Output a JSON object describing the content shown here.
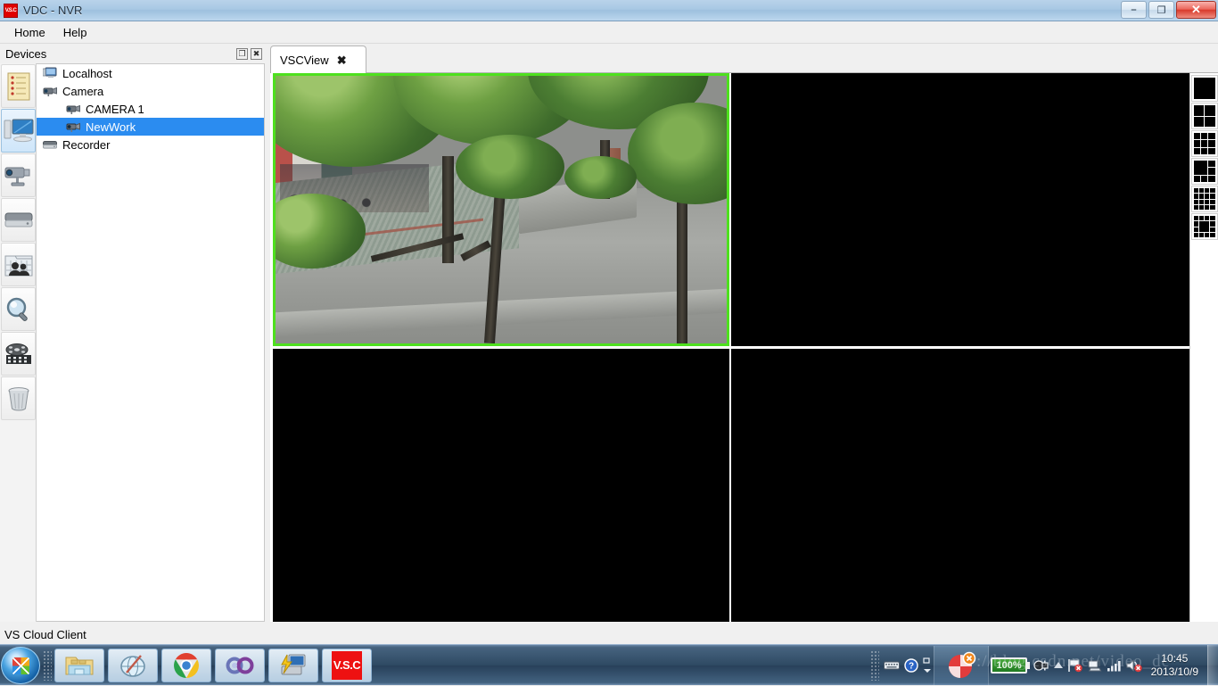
{
  "window": {
    "title": "VDC - NVR",
    "app_icon": "V.S.C",
    "controls": {
      "minimize": "–",
      "restore": "❐",
      "close": "✕"
    }
  },
  "menubar": {
    "items": [
      {
        "label": "Home",
        "icon": "menu-home"
      },
      {
        "label": "Help",
        "icon": "menu-help"
      }
    ]
  },
  "devices_dock": {
    "title": "Devices",
    "float_button": "❐",
    "close_button": "✖"
  },
  "rail": {
    "buttons": [
      {
        "name": "notes-list-icon",
        "active": false
      },
      {
        "name": "monitor-icon",
        "active": true
      },
      {
        "name": "camera-icon",
        "active": false
      },
      {
        "name": "harddisk-icon",
        "active": false
      },
      {
        "name": "users-group-icon",
        "active": false
      },
      {
        "name": "magnifier-search-icon",
        "active": false
      },
      {
        "name": "film-reel-icon",
        "active": false
      },
      {
        "name": "trash-bin-icon",
        "active": false
      }
    ]
  },
  "tree": {
    "nodes": [
      {
        "label": "Localhost",
        "level": 1,
        "icon": "computer-icon",
        "selected": false
      },
      {
        "label": "Camera",
        "level": 1,
        "icon": "camera-icon",
        "selected": false
      },
      {
        "label": "CAMERA 1",
        "level": 2,
        "icon": "camera-icon",
        "selected": false
      },
      {
        "label": "NewWork",
        "level": 2,
        "icon": "camera-icon",
        "selected": true
      },
      {
        "label": "Recorder",
        "level": 1,
        "icon": "harddisk-icon",
        "selected": false
      }
    ],
    "selection_color": "#2b8cf0"
  },
  "tabs": {
    "items": [
      {
        "label": "VSCView",
        "close": "✖",
        "active": true
      }
    ]
  },
  "video_grid": {
    "layout": "2x2",
    "active_border_color": "#4ee01e",
    "cells": [
      {
        "index": 1,
        "state": "live",
        "active": true,
        "label": ""
      },
      {
        "index": 2,
        "state": "empty",
        "active": false,
        "label": ""
      },
      {
        "index": 3,
        "state": "empty",
        "active": false,
        "label": ""
      },
      {
        "index": 4,
        "state": "empty",
        "active": false,
        "label": ""
      }
    ]
  },
  "layout_selector": {
    "options": [
      {
        "name": "layout-1",
        "cells": 1,
        "title": "1"
      },
      {
        "name": "layout-4",
        "cells": 4,
        "title": "4"
      },
      {
        "name": "layout-9",
        "cells": 9,
        "title": "9"
      },
      {
        "name": "layout-6",
        "cells": 6,
        "title": "6"
      },
      {
        "name": "layout-16",
        "cells": 16,
        "title": "16"
      },
      {
        "name": "layout-13",
        "cells": 13,
        "title": "13"
      }
    ]
  },
  "statusbar": {
    "text": "VS Cloud Client"
  },
  "taskbar": {
    "start_label": "Start",
    "buttons": [
      {
        "name": "file-explorer-icon",
        "label": ""
      },
      {
        "name": "browser-globe-icon",
        "label": ""
      },
      {
        "name": "chrome-icon",
        "label": ""
      },
      {
        "name": "infinity-app-icon",
        "label": ""
      },
      {
        "name": "remote-desktop-icon",
        "label": ""
      },
      {
        "name": "vsc-app-icon",
        "label": "V.S.C"
      }
    ],
    "tray": {
      "icons": [
        {
          "name": "keyboard-icon"
        },
        {
          "name": "help-question-icon"
        },
        {
          "name": "overflow-chevron-icon"
        },
        {
          "name": "chevron-up-icon"
        },
        {
          "name": "action-center-flag-icon"
        },
        {
          "name": "network-error-icon"
        },
        {
          "name": "signal-bars-icon"
        },
        {
          "name": "speaker-muted-icon"
        }
      ],
      "running_app": "vsc-tray-icon",
      "battery": {
        "percent": "100%",
        "level": 100
      },
      "power_plug": "power-plug-icon"
    },
    "clock": {
      "time": "10:45",
      "date": "2013/10/9"
    }
  },
  "watermark": {
    "text": "://blog.csdn.net/video_dc"
  }
}
